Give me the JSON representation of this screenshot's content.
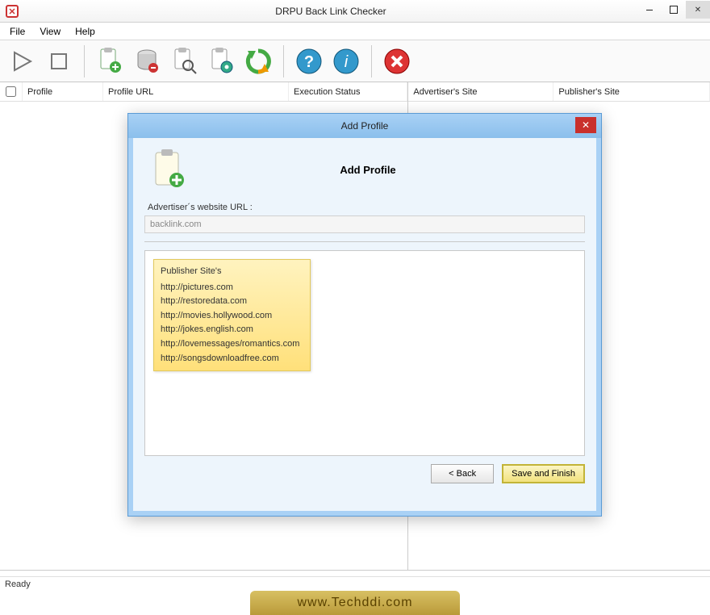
{
  "window": {
    "title": "DRPU Back Link Checker"
  },
  "menubar": {
    "items": [
      "File",
      "View",
      "Help"
    ]
  },
  "toolbar": {
    "icons": [
      "play-icon",
      "stop-icon",
      "add-profile-icon",
      "database-icon",
      "search-icon",
      "settings-icon",
      "refresh-icon",
      "help-icon",
      "info-icon",
      "close-icon"
    ]
  },
  "left_columns": {
    "check": "",
    "profile": "Profile",
    "url": "Profile URL",
    "status": "Execution Status"
  },
  "right_columns": {
    "adv": "Advertiser's Site",
    "pub": "Publisher's Site"
  },
  "statusbar": {
    "text": "Ready"
  },
  "dialog": {
    "titlebar": "Add Profile",
    "heading": "Add Profile",
    "url_label": "Advertiser´s website URL :",
    "url_value": "backlink.com",
    "note_title": "Publisher Site's",
    "note_items": [
      "http://pictures.com",
      "http://restoredata.com",
      "http://movies.hollywood.com",
      "http://jokes.english.com",
      "http://lovemessages/romantics.com",
      "http://songsdownloadfree.com"
    ],
    "back_btn": "< Back",
    "finish_btn": "Save and Finish"
  },
  "footer": {
    "text": "www.Techddi.com"
  }
}
